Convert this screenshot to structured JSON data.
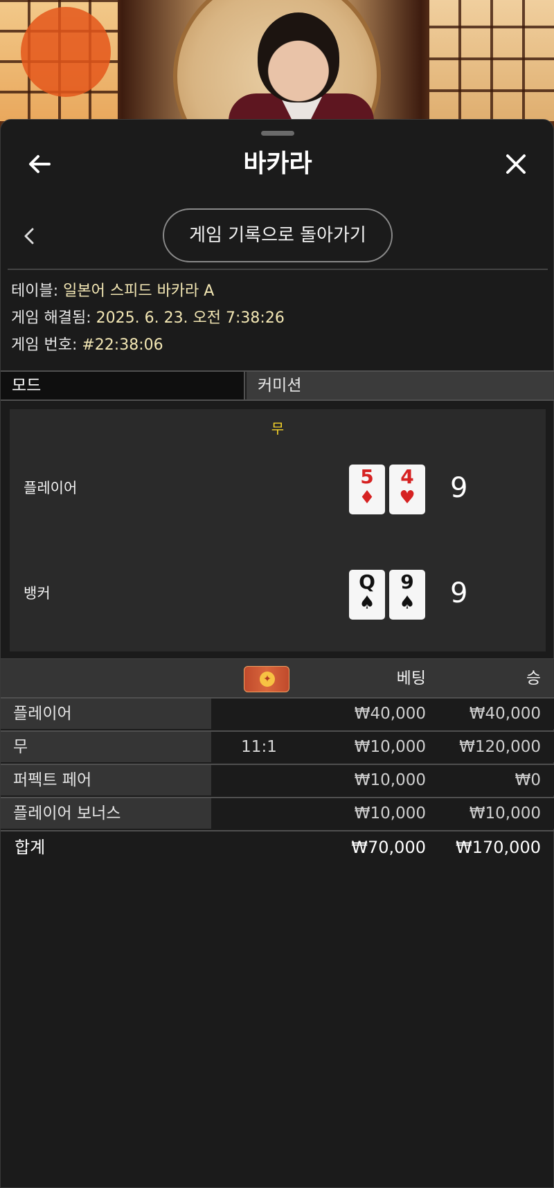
{
  "header": {
    "title": "바카라",
    "back_icon": "arrow-left-icon",
    "close_icon": "close-icon"
  },
  "history_nav": {
    "back_icon": "chevron-left-icon",
    "return_label": "게임 기록으로 돌아가기"
  },
  "info": {
    "table_label": "테이블:",
    "table_value": "일본어 스피드 바카라 A",
    "resolved_label": "게임 해결됨:",
    "resolved_value": "2025. 6. 23. 오전 7:38:26",
    "number_label": "게임 번호:",
    "number_value": "#22:38:06"
  },
  "mode": {
    "left": "모드",
    "right": "커미션"
  },
  "result": {
    "outcome": "무",
    "player": {
      "label": "플레이어",
      "score": "9",
      "cards": [
        {
          "rank": "5",
          "suit": "♦",
          "color": "red"
        },
        {
          "rank": "4",
          "suit": "♥",
          "color": "red"
        }
      ]
    },
    "banker": {
      "label": "뱅커",
      "score": "9",
      "cards": [
        {
          "rank": "Q",
          "suit": "♠",
          "color": "black"
        },
        {
          "rank": "9",
          "suit": "♠",
          "color": "black"
        }
      ]
    }
  },
  "bets": {
    "badge_icon": "lucky-red-envelope-icon",
    "col_bet": "베팅",
    "col_win": "승",
    "rows": [
      {
        "name": "플레이어",
        "odds": "",
        "bet": "₩40,000",
        "win": "₩40,000"
      },
      {
        "name": "무",
        "odds": "11:1",
        "bet": "₩10,000",
        "win": "₩120,000"
      },
      {
        "name": "퍼펙트 페어",
        "odds": "",
        "bet": "₩10,000",
        "win": "₩0"
      },
      {
        "name": "플레이어 보너스",
        "odds": "",
        "bet": "₩10,000",
        "win": "₩10,000"
      }
    ],
    "total": {
      "label": "합계",
      "bet": "₩70,000",
      "win": "₩170,000"
    }
  },
  "colors": {
    "accent_tie": "#f5d329",
    "info_value": "#f3e7b4",
    "card_red": "#d62222"
  }
}
